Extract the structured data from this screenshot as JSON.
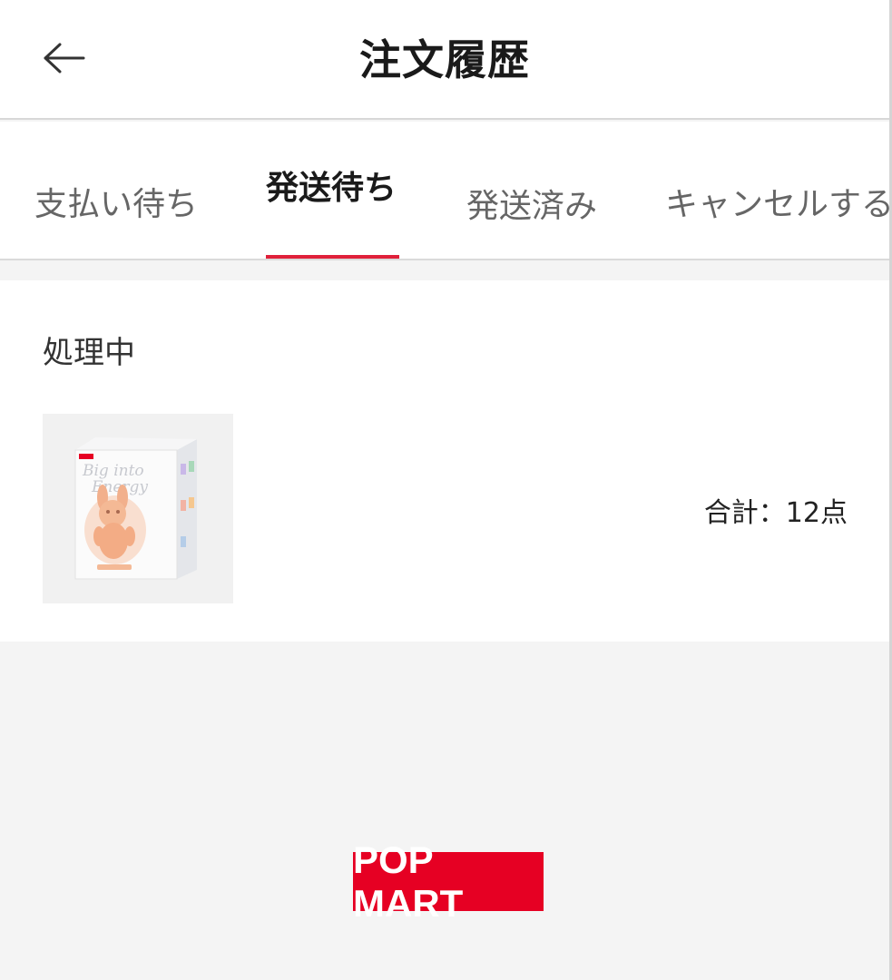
{
  "header": {
    "title": "注文履歴",
    "back_icon": "arrow-left-icon"
  },
  "tabs": [
    {
      "label": "支払い待ち",
      "active": false
    },
    {
      "label": "発送待ち",
      "active": true
    },
    {
      "label": "発送済み",
      "active": false
    },
    {
      "label": "キャンセルする",
      "active": false
    }
  ],
  "order": {
    "status": "処理中",
    "total": "合計：12点",
    "product_image": {
      "box_brand": "POP MART",
      "box_text": "Big into Energy"
    }
  },
  "footer": {
    "brand": "POP MART"
  },
  "colors": {
    "accent": "#e0203a",
    "brand": "#e60023",
    "background": "#f4f4f4"
  }
}
